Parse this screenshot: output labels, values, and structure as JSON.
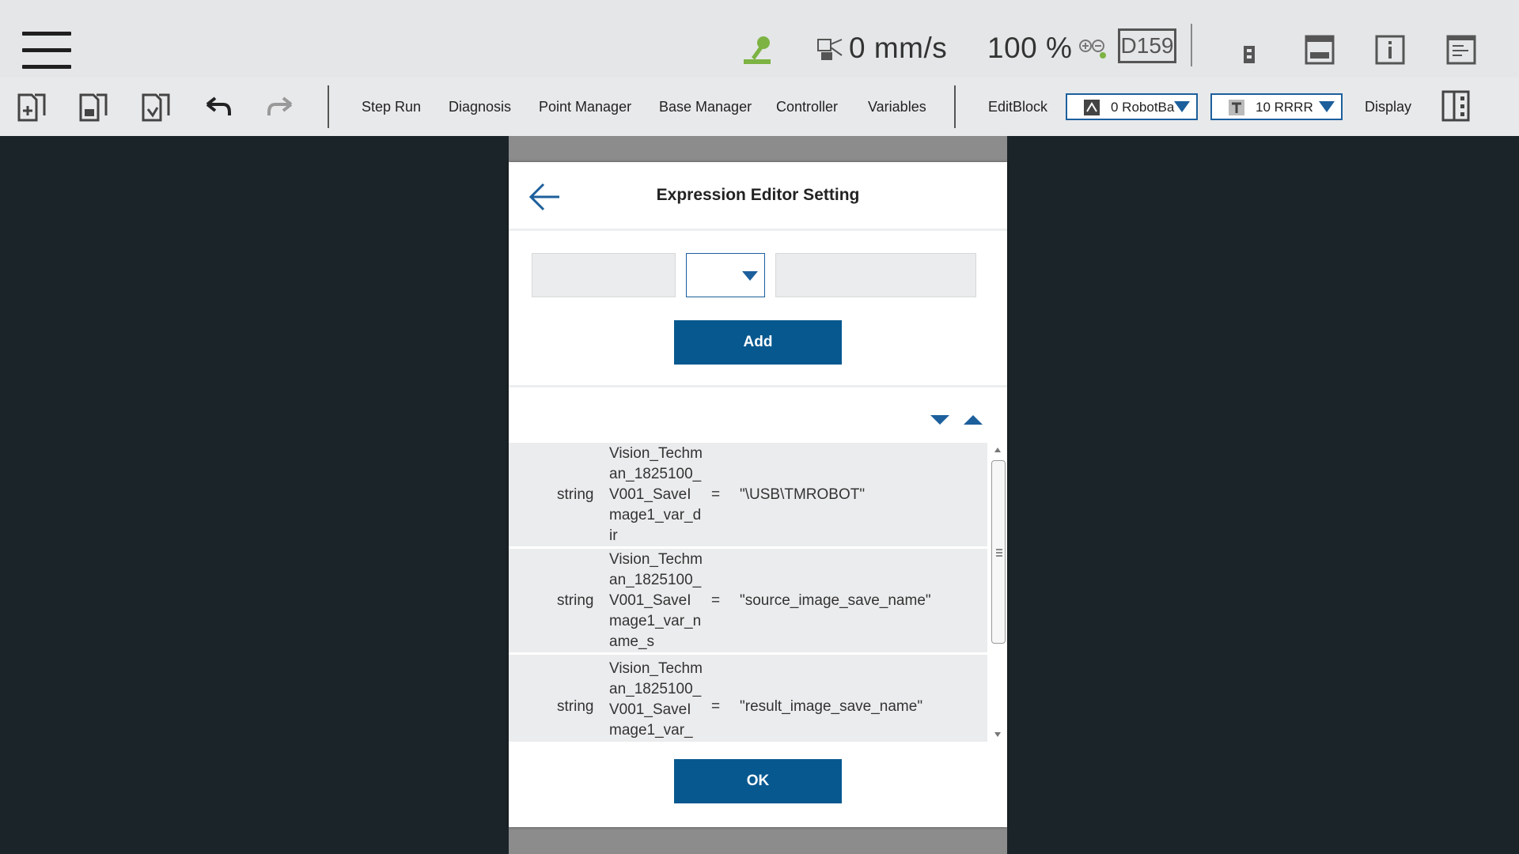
{
  "status": {
    "speed": "0 mm/s",
    "percent": "100 %",
    "project_code": "D159"
  },
  "toolbar": {
    "step_run": "Step Run",
    "diagnosis": "Diagnosis",
    "point_manager": "Point Manager",
    "base_manager": "Base Manager",
    "controller": "Controller",
    "variables": "Variables",
    "edit_block": "EditBlock",
    "base_select": "0 RobotBa",
    "tcp_select": "10 RRRR",
    "display": "Display"
  },
  "dialog": {
    "title": "Expression Editor Setting",
    "left_value": "",
    "operator_value": "",
    "right_value": "",
    "add_label": "Add",
    "ok_label": "OK",
    "rows": [
      {
        "type": "string",
        "name": "Vision_Techman_1825100_V001_SaveImage1_var_dir",
        "eq": "=",
        "value": "\"\\USB\\TMROBOT\""
      },
      {
        "type": "string",
        "name": "Vision_Techman_1825100_V001_SaveImage1_var_name_s",
        "eq": "=",
        "value": "\"source_image_save_name\""
      },
      {
        "type": "string",
        "name": "Vision_Techman_1825100_V001_SaveImage1_var_",
        "eq": "=",
        "value": "\"result_image_save_name\""
      }
    ]
  },
  "colors": {
    "accent": "#07588f",
    "background": "#1b2428",
    "topbar": "#e4e6e7"
  }
}
